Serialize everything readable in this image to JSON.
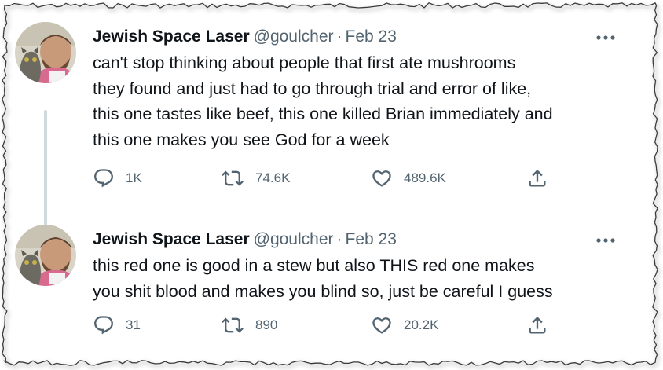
{
  "tweets": [
    {
      "display_name": "Jewish Space Laser",
      "handle": "@goulcher",
      "separator": "·",
      "date": "Feb 23",
      "text": "can't stop thinking about people that first ate mushrooms\nthey found and just had to go through trial and error of like,\nthis one tastes like beef, this one killed Brian immediately and\nthis one makes you see God for a week",
      "replies": "1K",
      "retweets": "74.6K",
      "likes": "489.6K",
      "icons": {
        "more": "more-icon",
        "reply": "reply-icon",
        "retweet": "retweet-icon",
        "like": "heart-icon",
        "share": "share-icon"
      }
    },
    {
      "display_name": "Jewish Space Laser",
      "handle": "@goulcher",
      "separator": "·",
      "date": "Feb 23",
      "text": "this red one is good in a stew but also THIS red one makes\nyou shit blood and makes you blind so, just be careful I guess",
      "replies": "31",
      "retweets": "890",
      "likes": "20.2K",
      "icons": {
        "more": "more-icon",
        "reply": "reply-icon",
        "retweet": "retweet-icon",
        "like": "heart-icon",
        "share": "share-icon"
      }
    }
  ],
  "colors": {
    "text": "#0f1419",
    "secondary": "#536471",
    "thread_line": "#cfd9de"
  }
}
